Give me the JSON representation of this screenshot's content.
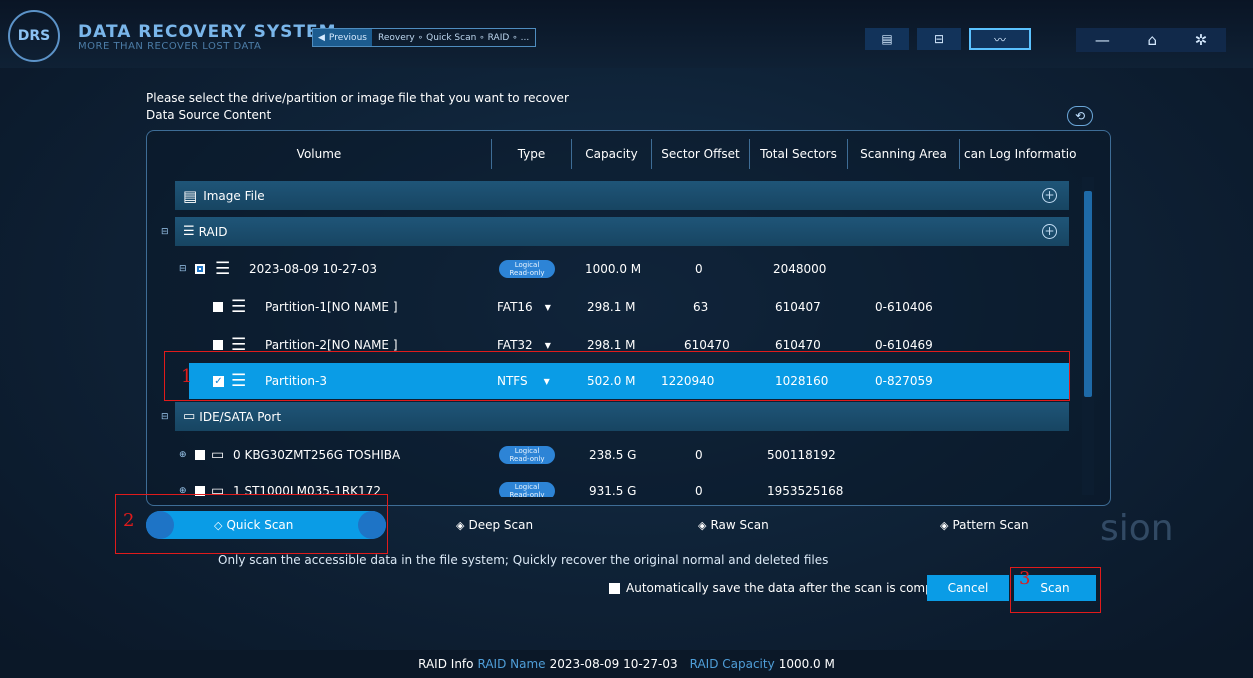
{
  "app": {
    "title": "DATA RECOVERY SYSTEM",
    "subtitle": "MORE THAN RECOVER LOST DATA",
    "logo_text": "DRS"
  },
  "breadcrumb": {
    "previous": "Previous",
    "path": "Reovery ∘ Quick Scan ∘ RAID ∘ ..."
  },
  "instructions": {
    "line1": "Please select the drive/partition or image file that you want to recover",
    "line2": "Data Source Content"
  },
  "table": {
    "headers": [
      "Volume",
      "Type",
      "Capacity",
      "Sector Offset",
      "Total Sectors",
      "Scanning Area",
      "can Log Informatio"
    ],
    "groups": {
      "image_file": "Image File",
      "raid": "RAID",
      "ide_sata": "IDE/SATA Port"
    },
    "badge": {
      "line1": "Logical",
      "line2": "Read-only"
    },
    "raid_row": {
      "name": "2023-08-09 10-27-03",
      "capacity": "1000.0 M",
      "offset": "0",
      "total": "2048000"
    },
    "partitions": [
      {
        "name": "Partition-1[NO NAME   ]",
        "type": "FAT16",
        "capacity": "298.1 M",
        "offset": "63",
        "total": "610407",
        "area": "0-610406"
      },
      {
        "name": "Partition-2[NO NAME   ]",
        "type": "FAT32",
        "capacity": "298.1 M",
        "offset": "610470",
        "total": "610470",
        "area": "0-610469"
      },
      {
        "name": "Partition-3",
        "type": "NTFS",
        "capacity": "502.0 M",
        "offset": "1220940",
        "total": "1028160",
        "area": "0-827059"
      }
    ],
    "disks": [
      {
        "name": "0  KBG30ZMT256G TOSHIBA",
        "capacity": "238.5 G",
        "offset": "0",
        "total": "500118192"
      },
      {
        "name": "1  ST1000LM035-1RK172",
        "capacity": "931.5 G",
        "offset": "0",
        "total": "1953525168"
      }
    ]
  },
  "scan_modes": {
    "quick": "Quick Scan",
    "deep": "Deep Scan",
    "raw": "Raw Scan",
    "pattern": "Pattern Scan"
  },
  "description": "Only scan the accessible data in the file system; Quickly recover the original normal and deleted files",
  "autosave": "Automatically save the data after the scan is complete",
  "buttons": {
    "cancel": "Cancel",
    "scan": "Scan"
  },
  "annotations": {
    "one": "1",
    "two": "2",
    "three": "3"
  },
  "watermark": "sion",
  "footer": {
    "label": "RAID Info",
    "name_key": "RAID Name",
    "name_val": "2023-08-09 10-27-03",
    "cap_key": "RAID Capacity",
    "cap_val": "1000.0 M"
  },
  "colors": {
    "accent": "#0a9ce6",
    "annotation": "#e01b1b"
  }
}
